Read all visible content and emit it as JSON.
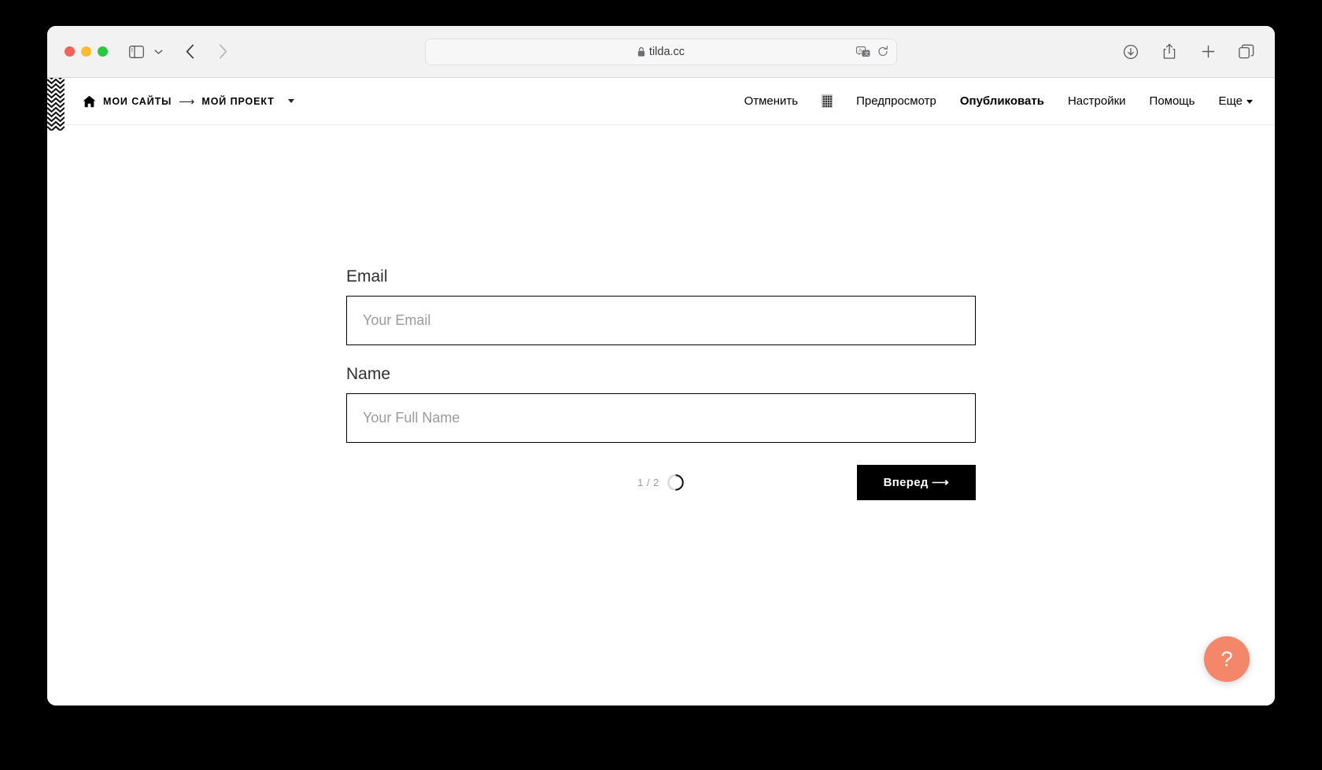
{
  "browser": {
    "traffic_lights": {
      "close_color": "#ff5f57",
      "minimize_color": "#febc2e",
      "maximize_color": "#28c840"
    },
    "sidebar_toggle_icon": "sidebar-icon",
    "sidebar_dropdown_icon": "chevron-down-icon",
    "back_icon": "chevron-left-icon",
    "forward_icon": "chevron-right-icon",
    "address": {
      "lock_icon": "lock-icon",
      "url": "tilda.cc",
      "translate_icon": "translate-icon",
      "reload_icon": "reload-icon"
    },
    "toolbar_right": [
      {
        "name": "downloads-icon",
        "label": "Downloads"
      },
      {
        "name": "share-icon",
        "label": "Share"
      },
      {
        "name": "new-tab-icon",
        "label": "New Tab"
      },
      {
        "name": "tab-overview-icon",
        "label": "Tab Overview"
      }
    ]
  },
  "topbar": {
    "logo_icon": "tilda-zigzag-logo",
    "home_icon": "home-icon",
    "breadcrumb": {
      "root": "МОИ САЙТЫ",
      "separator": "⟶",
      "current": "МОЙ ПРОЕКТ",
      "caret_icon": "chevron-down-icon"
    },
    "nav": [
      {
        "label": "Отменить",
        "bold": false,
        "name": "nav-undo"
      },
      {
        "label": "Предпросмотр",
        "bold": false,
        "name": "nav-preview"
      },
      {
        "label": "Опубликовать",
        "bold": true,
        "name": "nav-publish"
      },
      {
        "label": "Настройки",
        "bold": false,
        "name": "nav-settings"
      },
      {
        "label": "Помощь",
        "bold": false,
        "name": "nav-help"
      },
      {
        "label": "Еще",
        "bold": false,
        "name": "nav-more"
      }
    ],
    "grid_icon": "grid-view-icon"
  },
  "form": {
    "fields": [
      {
        "label": "Email",
        "placeholder": "Your Email",
        "value": ""
      },
      {
        "label": "Name",
        "placeholder": "Your Full Name",
        "value": ""
      }
    ],
    "step": {
      "text": "1 / 2",
      "current": 1,
      "total": 2,
      "percent": 50
    },
    "submit_label": "Вперед ⟶"
  },
  "help_bubble": {
    "symbol": "?",
    "color": "#f4876a",
    "icon": "question-mark-icon"
  }
}
